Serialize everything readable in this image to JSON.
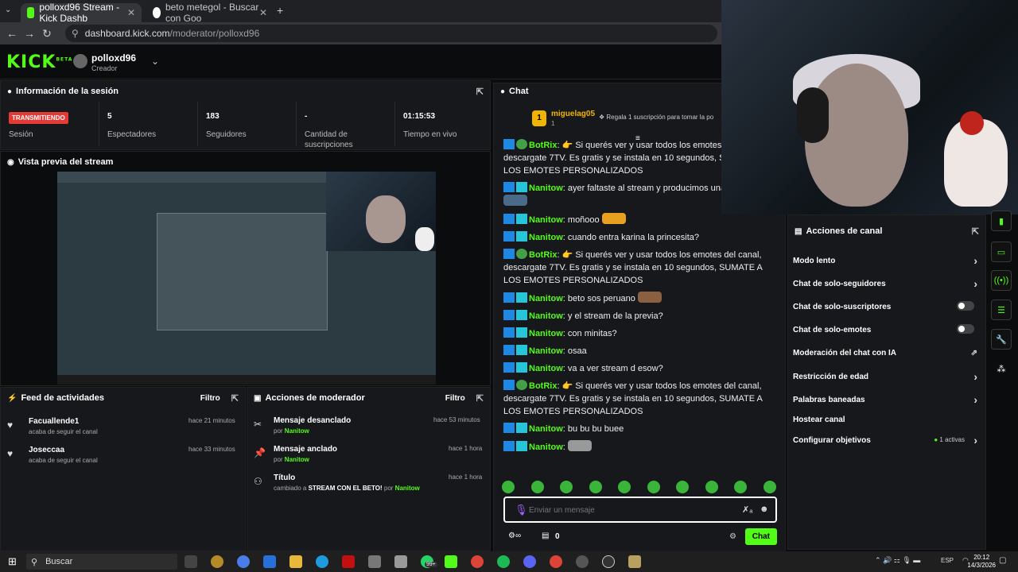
{
  "browser": {
    "tabs": [
      {
        "label": "polloxd96 Stream - Kick Dashb"
      },
      {
        "label": "beto metegol - Buscar con Goo"
      }
    ],
    "url_host": "dashboard.kick.com",
    "url_path": "/moderator/polloxd96"
  },
  "header": {
    "logo": "KICK",
    "logo_badge": "BETA",
    "username": "polloxd96",
    "role": "Creador"
  },
  "session": {
    "title": "Información de la sesión",
    "status_badge": "TRANSMITIENDO",
    "status_label": "Sesión",
    "viewers_value": "5",
    "viewers_label": "Espectadores",
    "followers_value": "183",
    "followers_label": "Seguidores",
    "subs_value": "-",
    "subs_label": "Cantidad de suscripciones",
    "live_value": "01:15:53",
    "live_label": "Tiempo en vivo"
  },
  "preview": {
    "title": "Vista previa del stream"
  },
  "activity": {
    "title": "Feed de actividades",
    "filter": "Filtro",
    "items": [
      {
        "name": "Facuallende1",
        "sub": "acaba de seguir el canal",
        "time": "hace 21 minutos"
      },
      {
        "name": "Joseccaa",
        "sub": "acaba de seguir el canal",
        "time": "hace 33 minutos"
      }
    ]
  },
  "modactions": {
    "title": "Acciones de moderador",
    "filter": "Filtro",
    "by": "por",
    "items": [
      {
        "title": "Mensaje desanclado",
        "by": "Nanitow",
        "time": "hace 53 minutos"
      },
      {
        "title": "Mensaje anclado",
        "by": "Nanitow",
        "time": "hace 1 hora"
      },
      {
        "title": "Título",
        "changed": "cambiado a",
        "value": "STREAM CON EL BETO!",
        "by": "Nanitow",
        "time": "hace 1 hora"
      }
    ]
  },
  "chat": {
    "title": "Chat",
    "pinned_user": "miguelag05",
    "pinned_level": "1",
    "pinned_count": "1",
    "pinned_text": "Regala 1 suscripción para tomar la po",
    "messages": [
      {
        "user": "BotRix",
        "text": " Si querés ver y usar todos los emotes del canal, descargate 7TV. Es gratis y se instala en 10 segundos, SUMATE A LOS EMOTES PERSONALIZADOS"
      },
      {
        "user": "Nanitow",
        "text": " ayer faltaste al stream y producimos una"
      },
      {
        "user": "Nanitow",
        "text": " moñooo"
      },
      {
        "user": "Nanitow",
        "text": " cuando entra karina la princesita?"
      },
      {
        "user": "BotRix",
        "text": " Si querés ver y usar todos los emotes del canal, descargate 7TV. Es gratis y se instala en 10 segundos, SUMATE A LOS EMOTES PERSONALIZADOS"
      },
      {
        "user": "Nanitow",
        "text": " beto sos peruano"
      },
      {
        "user": "Nanitow",
        "text": " y el stream de la previa?"
      },
      {
        "user": "Nanitow",
        "text": " con minitas?"
      },
      {
        "user": "Nanitow",
        "text": " osaa"
      },
      {
        "user": "Nanitow",
        "text": " va a ver stream d esow?"
      },
      {
        "user": "BotRix",
        "text": " Si querés ver y usar todos los emotes del canal, descargate 7TV. Es gratis y se instala en 10 segundos, SUMATE A LOS EMOTES PERSONALIZADOS"
      },
      {
        "user": "Nanitow",
        "text": " bu bu bu buee"
      },
      {
        "user": "Nanitow",
        "text": ""
      }
    ],
    "input_placeholder": "Enviar un mensaje",
    "viewers_count": "0",
    "send_label": "Chat"
  },
  "channel_actions": {
    "title": "Acciones de canal",
    "slow": "Modo lento",
    "followers": "Chat de solo-seguidores",
    "subs": "Chat de solo-suscriptores",
    "emotes": "Chat de solo-emotes",
    "ai": "Moderación del chat con IA",
    "age": "Restricción de edad",
    "banned": "Palabras baneadas",
    "host": "Hostear canal",
    "goals": "Configurar objetivos",
    "goals_badge": "1 activas"
  },
  "taskbar": {
    "search": "Buscar",
    "badge": "99+",
    "lang": "ESP",
    "time": "20:12",
    "date": "14/3/2026"
  }
}
